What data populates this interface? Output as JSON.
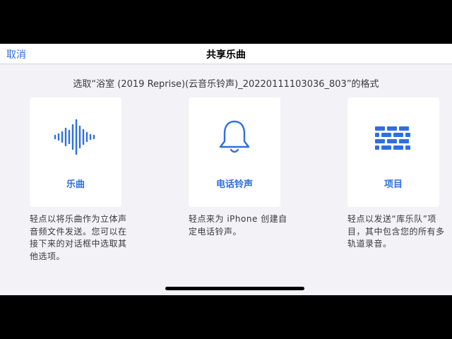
{
  "navbar": {
    "cancel_label": "取消",
    "title": "共享乐曲"
  },
  "subtitle": "选取“浴室 (2019 Reprise)(云音乐铃声)_20220111103036_803”的格式",
  "options": [
    {
      "icon": "waveform-icon",
      "label": "乐曲",
      "description": "轻点以将乐曲作为立体声音频文件发送。您可以在接下来的对话框中选取其他选项。"
    },
    {
      "icon": "bell-icon",
      "label": "电话铃声",
      "description": "轻点来为 iPhone 创建自定电话铃声。"
    },
    {
      "icon": "brick-wall-icon",
      "label": "项目",
      "description": "轻点以发送“库乐队”项目，其中包含您的所有多轨道录音。"
    }
  ],
  "colors": {
    "accent": "#2f6fe0",
    "background": "#f2f2f7",
    "card": "#ffffff"
  }
}
